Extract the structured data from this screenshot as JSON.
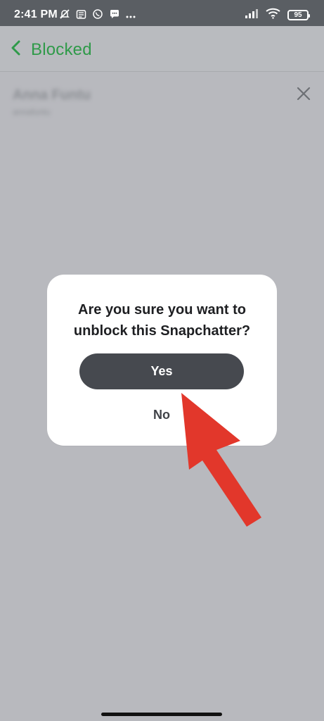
{
  "status_bar": {
    "time": "2:41 PM",
    "battery": "95",
    "left_icons": [
      "muted-notification-icon",
      "news-icon",
      "whatsapp-icon",
      "chat-bubble-icon",
      "more-dots-icon"
    ],
    "right_icons": [
      "signal-icon",
      "wifi-icon",
      "battery-icon"
    ]
  },
  "header": {
    "back_label": "Blocked",
    "accent_color": "#2f9a49"
  },
  "blocked_list": {
    "items": [
      {
        "name": "Anna Funtu",
        "username": "annafuntu"
      }
    ],
    "remove_icon": "close-icon"
  },
  "dialog": {
    "title": "Are you sure you want to\nunblock this Snapchatter?",
    "confirm_label": "Yes",
    "cancel_label": "No",
    "confirm_color": "#46494f"
  },
  "annotation": {
    "arrow_color": "#e2372b"
  }
}
